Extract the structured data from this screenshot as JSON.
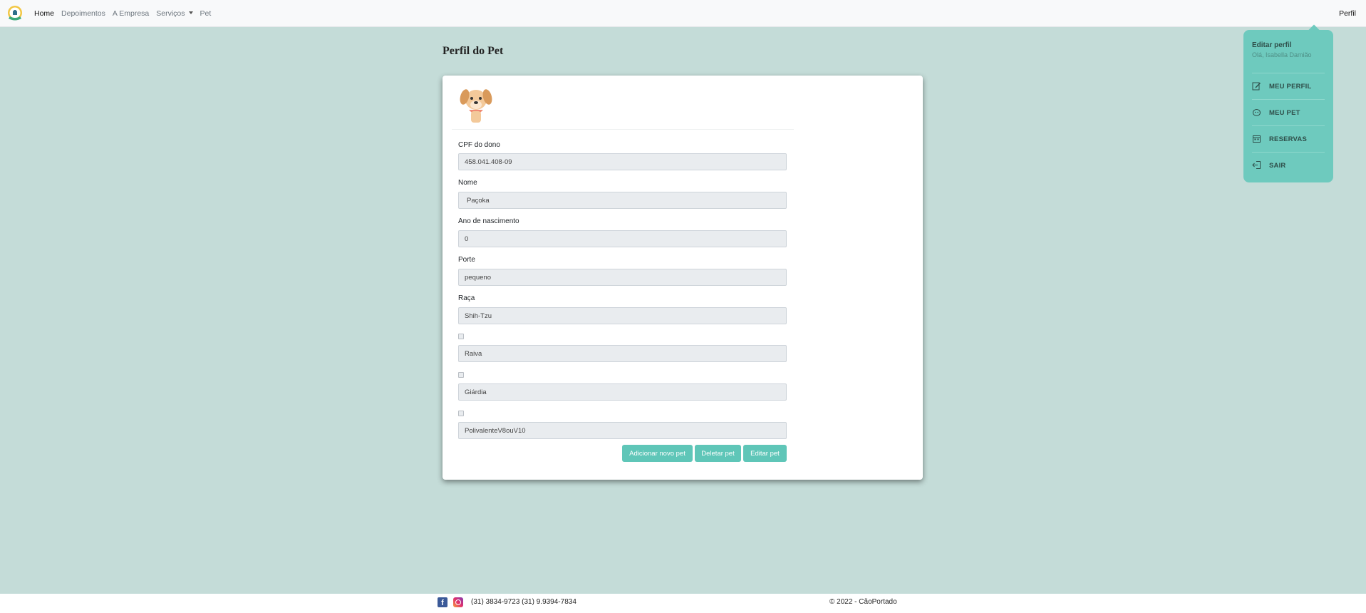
{
  "navbar": {
    "links": [
      "Home",
      "Depoimentos",
      "A Empresa",
      "Serviços",
      "Pet"
    ],
    "right_link": "Perfil"
  },
  "page": {
    "title": "Perfil do Pet"
  },
  "form": {
    "owner_cpf": {
      "label": "CPF do dono",
      "value": "458.041.408-09"
    },
    "name": {
      "label": "Nome",
      "value": "Paçoka"
    },
    "birth_year": {
      "label": "Ano de nascimento",
      "value": "0"
    },
    "size": {
      "label": "Porte",
      "value": "pequeno"
    },
    "breed": {
      "label": "Raça",
      "value": "Shih-Tzu"
    },
    "vaccines": [
      "Raiva",
      "Giárdia",
      "PolivalenteV8ouV10"
    ]
  },
  "buttons": {
    "add": "Adicionar novo pet",
    "delete": "Deletar pet",
    "edit": "Editar pet"
  },
  "profile_menu": {
    "title": "Editar perfil",
    "greeting": "Olá, Isabella Damião",
    "items": [
      "MEU PERFIL",
      "MEU PET",
      "RESERVAS",
      "SAIR"
    ]
  },
  "footer": {
    "phones": "(31) 3834-9723 (31) 9.9394-7834",
    "copyright": "© 2022 - CãoPortado"
  },
  "colors": {
    "page_background": "#c4dcd8",
    "accent": "#5fc6b8",
    "menu_background": "#6ecabe"
  }
}
